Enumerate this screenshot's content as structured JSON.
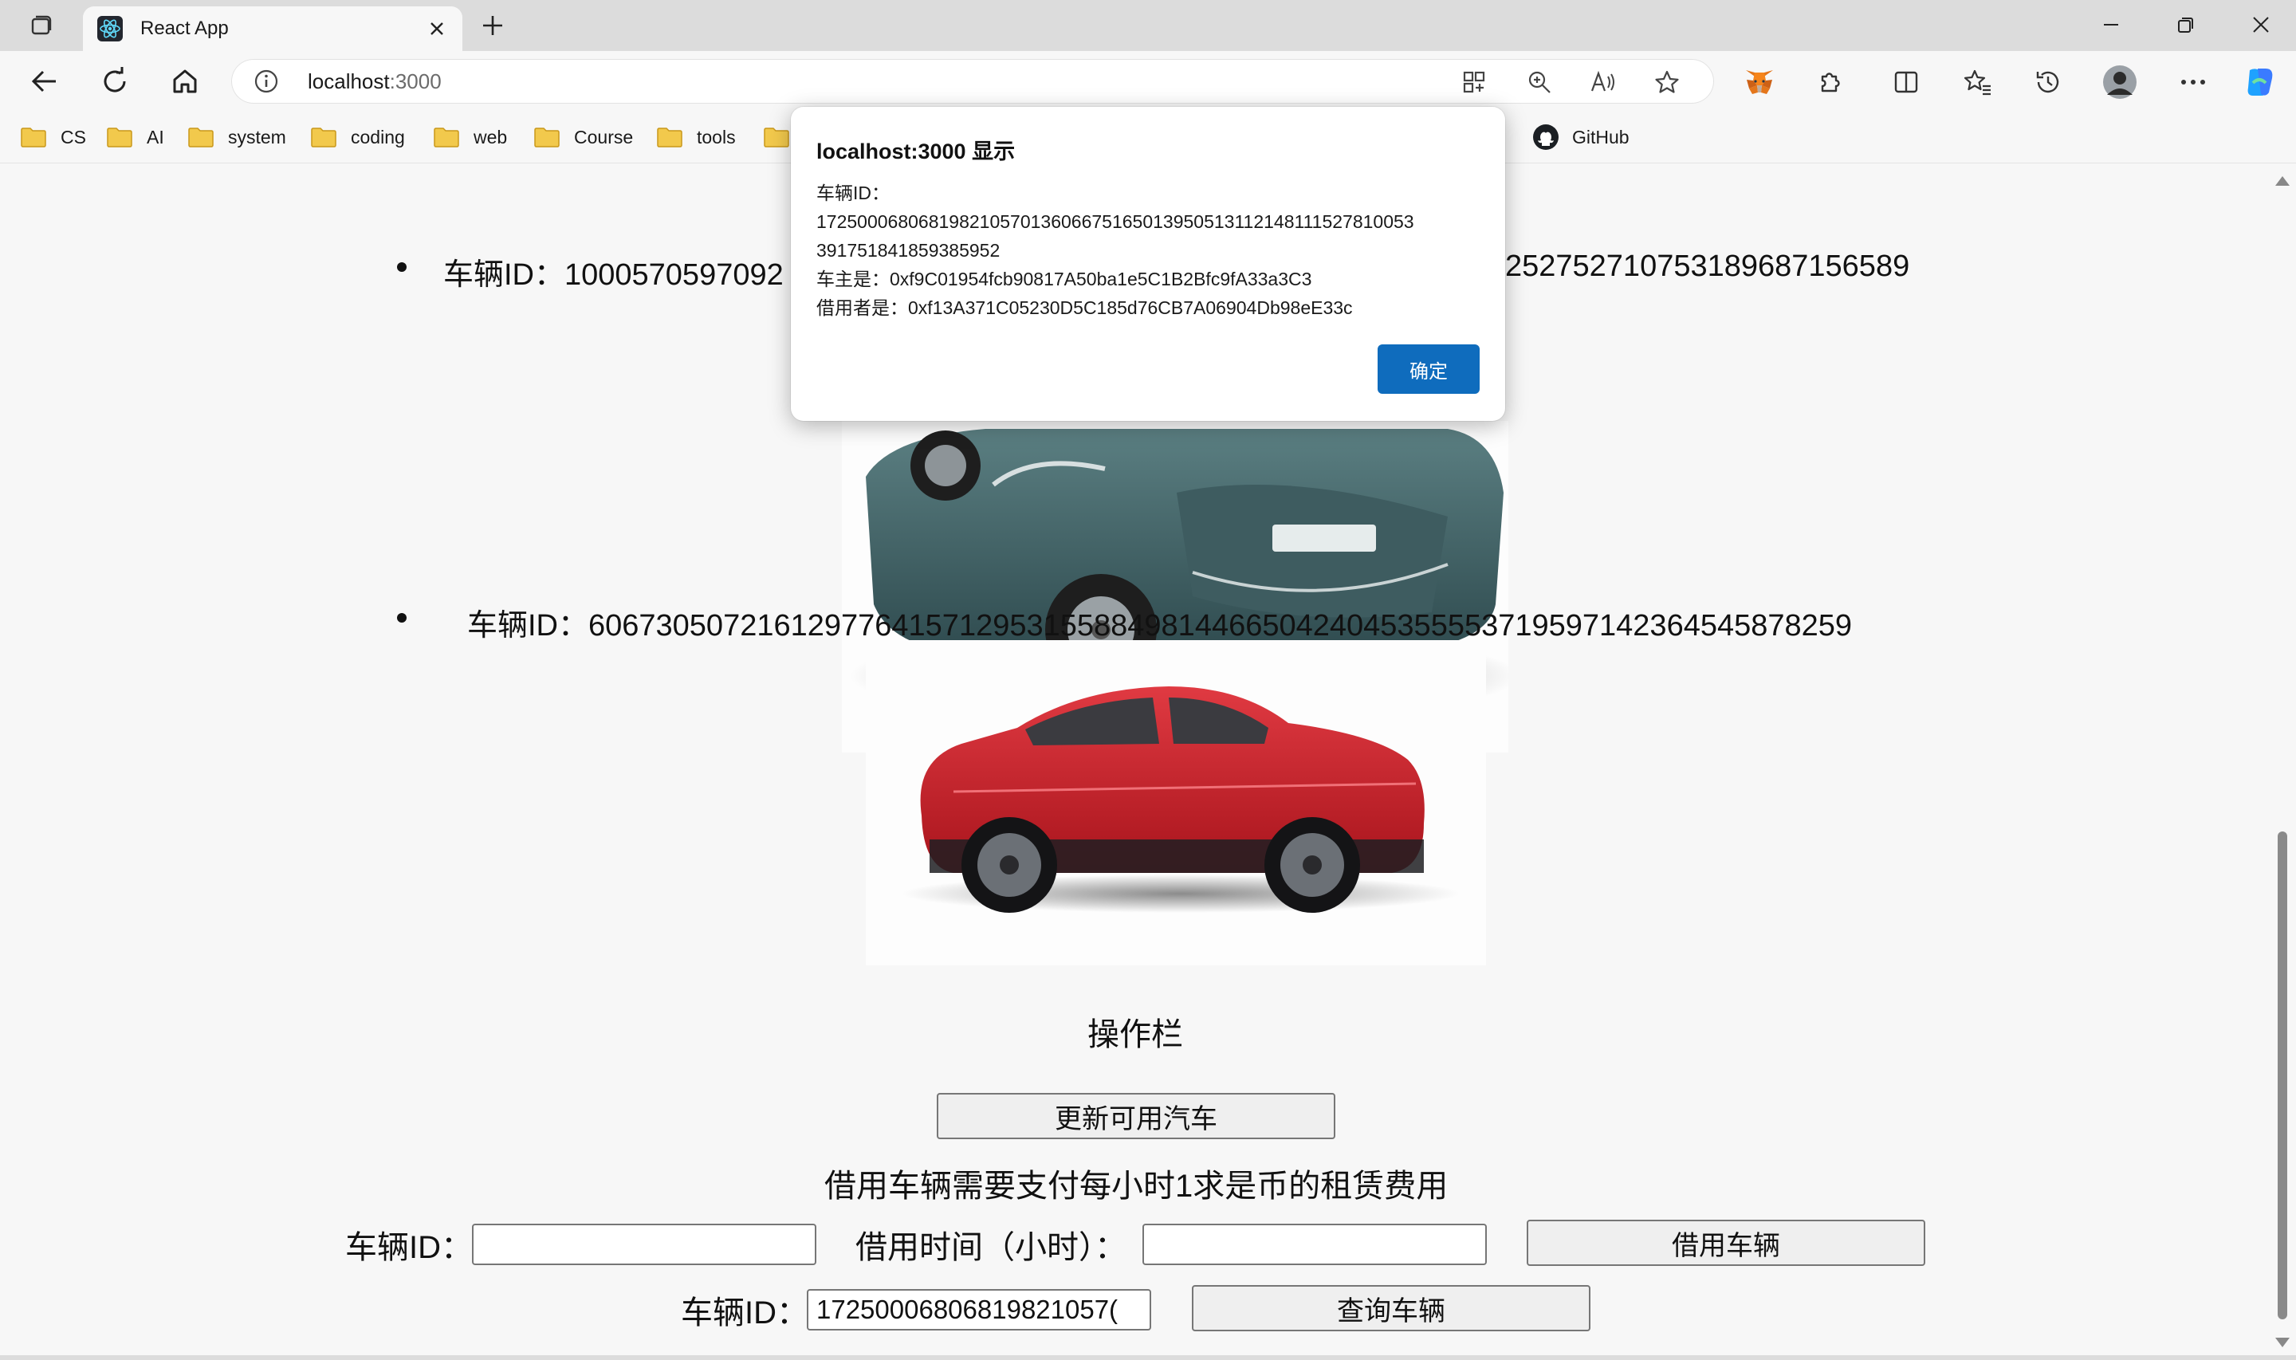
{
  "browser": {
    "tab": {
      "title": "React App"
    },
    "address": {
      "host": "localhost",
      "port": ":3000"
    },
    "bookmarks": [
      {
        "label": "CS"
      },
      {
        "label": "AI"
      },
      {
        "label": "system"
      },
      {
        "label": "coding"
      },
      {
        "label": "web"
      },
      {
        "label": "Course"
      },
      {
        "label": "tools"
      },
      {
        "label": ""
      }
    ],
    "github_bookmark": "GitHub"
  },
  "page": {
    "vehicles": [
      {
        "id_line": "车辆ID：1000570597092",
        "id_line_tail": "252752710753189687156589",
        "image": "teal-suv"
      },
      {
        "id_line": "车辆ID：60673050721612977641571295315588498144665042404535555371959714236454587825​9",
        "image": "red-suv"
      }
    ],
    "ops_title": "操作栏",
    "update_button": "更新可用汽车",
    "rent_notice": "借用车辆需要支付每小时1求是币的租赁费用",
    "borrow_form": {
      "id_label": "车辆ID：",
      "id_value": "",
      "hours_label": "借用时间（小时）：",
      "hours_value": "",
      "submit": "借用车辆"
    },
    "query_form": {
      "id_label": "车辆ID：",
      "id_value": "17250006806819821057(",
      "submit": "查询车辆"
    }
  },
  "dialog": {
    "title": "localhost:3000 显示",
    "line1": "车辆ID：",
    "line2": "1725000680681982105701360667516501395051311214811152781005​3",
    "line3": "391751841859385952",
    "line4": "车主是：0xf9C01954fcb90817A50ba1e5C1B2Bfc9fA33a3C3",
    "line5": "借用者是：0xf13A371C05230D5C185d76CB7A06904Db98eE33c",
    "ok": "确定"
  },
  "colors": {
    "accent": "#0f6cbd",
    "chrome": "#dcdcdc",
    "page_bg": "#f7f7f7"
  }
}
